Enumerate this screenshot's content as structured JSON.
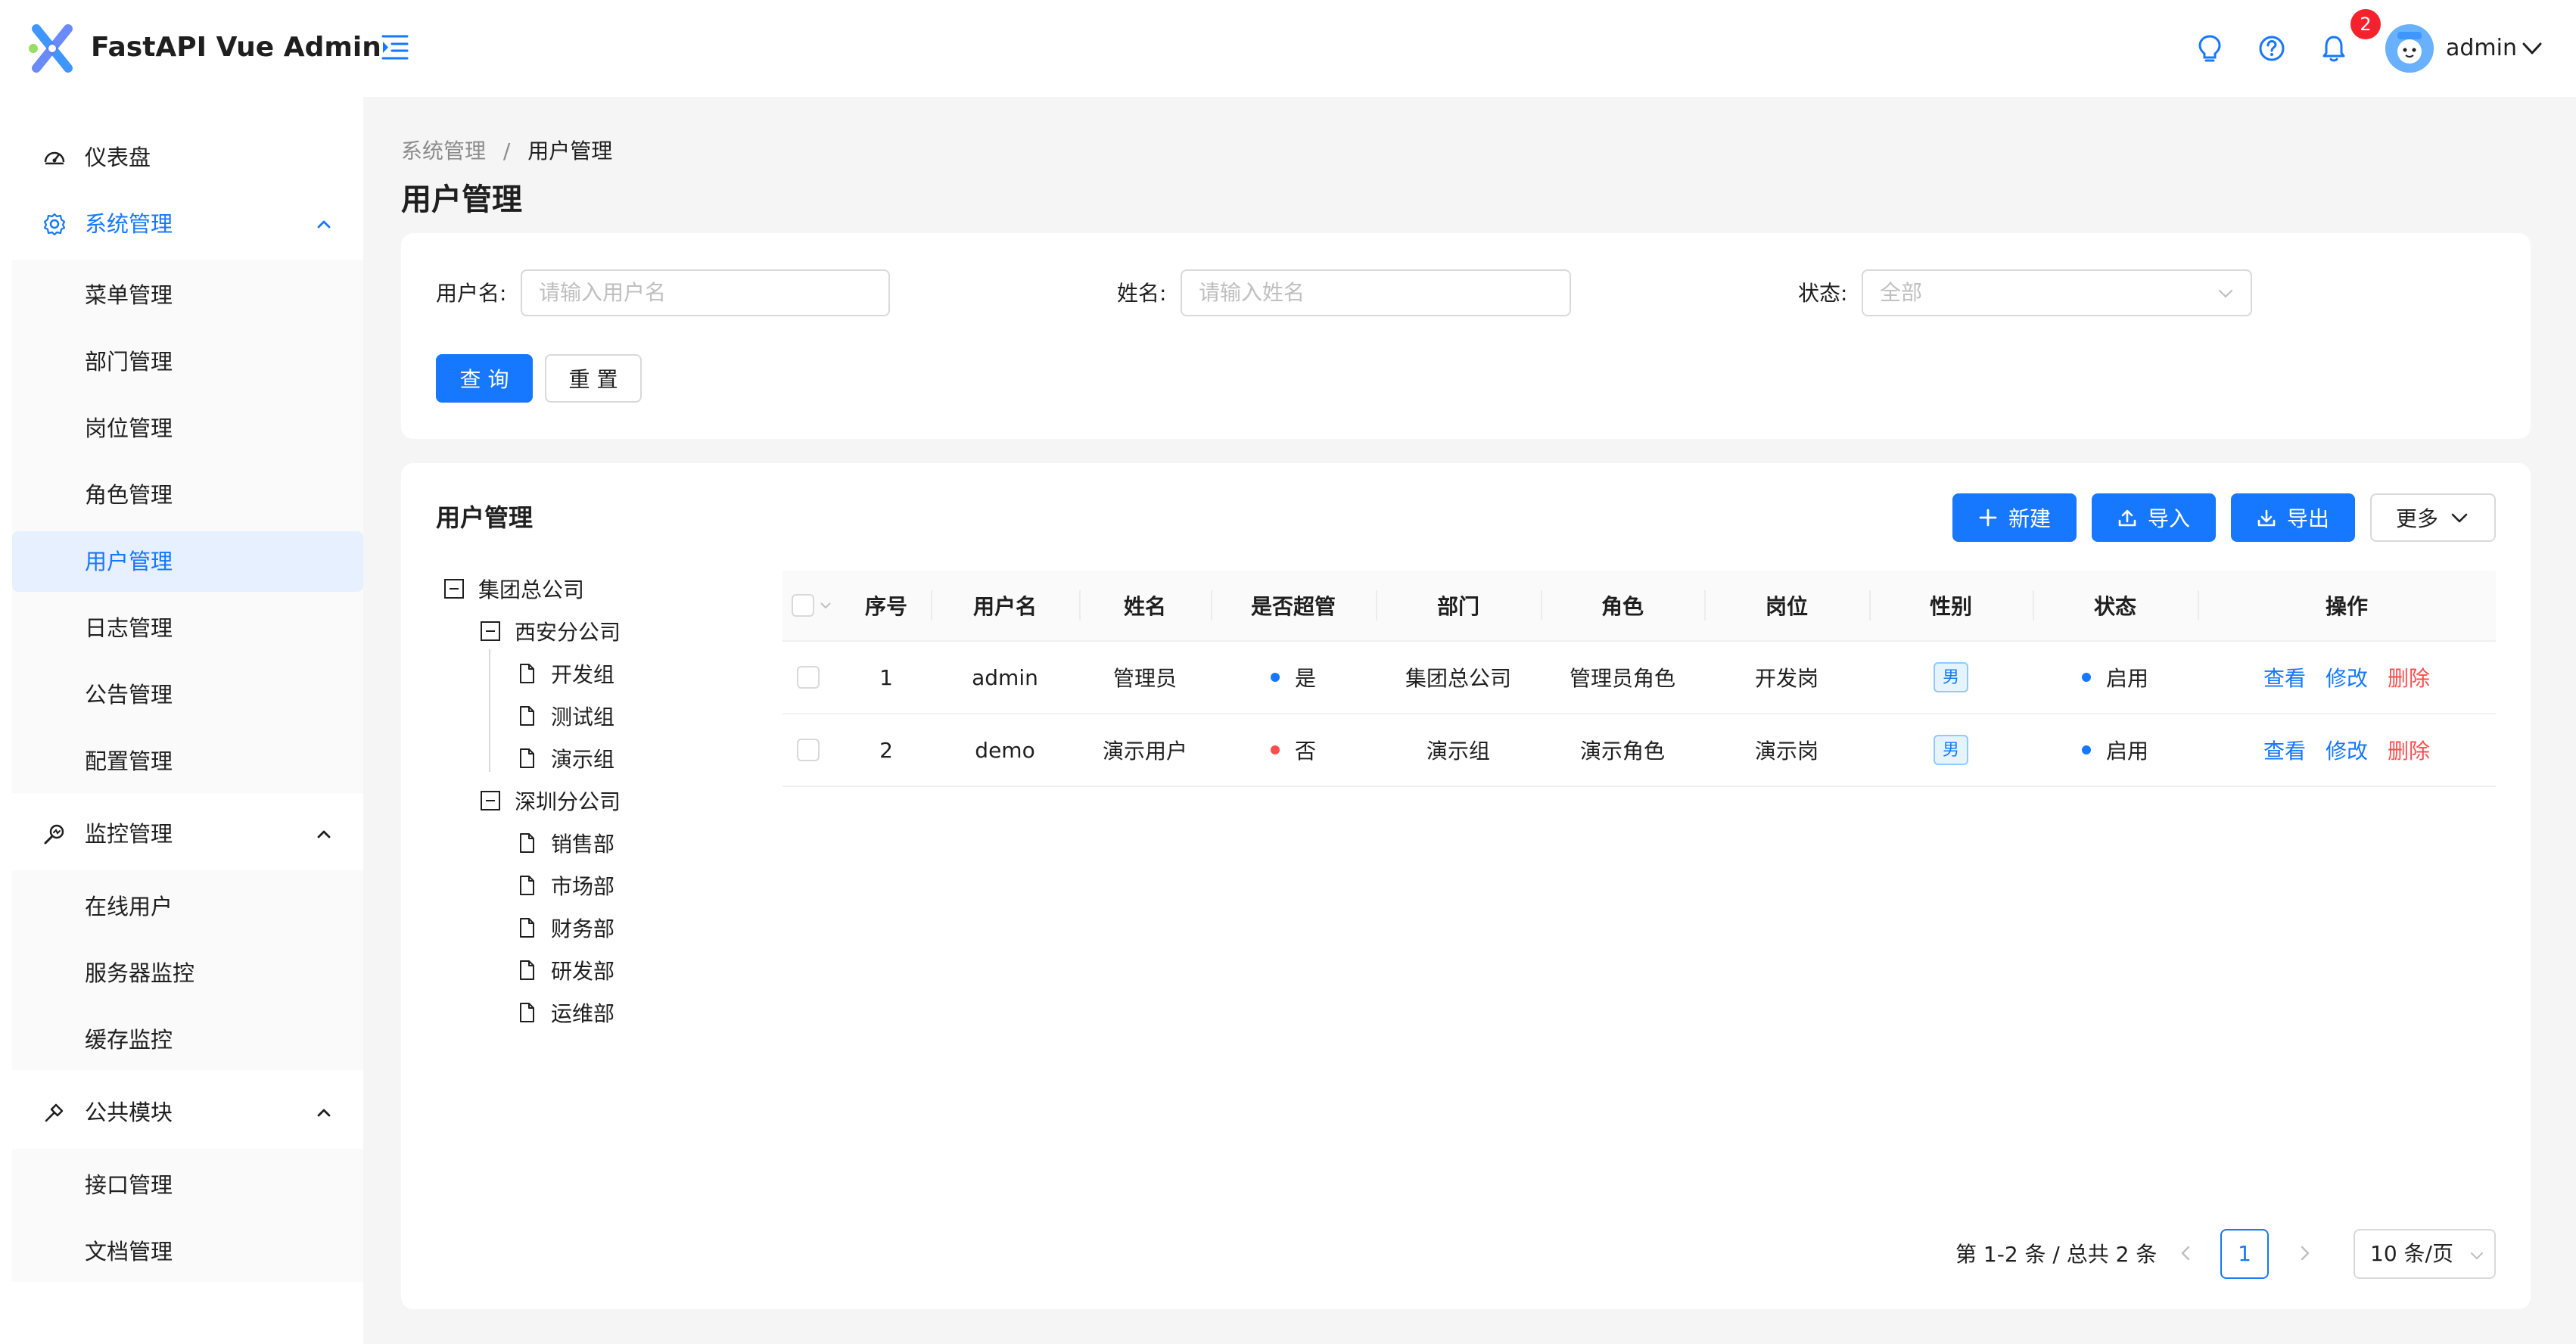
{
  "app": {
    "title": "FastAPI Vue Admin"
  },
  "header": {
    "notification_count": "2",
    "user_name": "admin"
  },
  "sidebar": {
    "items": [
      {
        "label": "仪表盘",
        "icon": "dashboard-icon"
      },
      {
        "label": "系统管理",
        "icon": "gear-icon",
        "expanded": true,
        "children": [
          "菜单管理",
          "部门管理",
          "岗位管理",
          "角色管理",
          "用户管理",
          "日志管理",
          "公告管理",
          "配置管理"
        ]
      },
      {
        "label": "监控管理",
        "icon": "monitor-icon",
        "expanded": true,
        "children": [
          "在线用户",
          "服务器监控",
          "缓存监控"
        ]
      },
      {
        "label": "公共模块",
        "icon": "module-icon",
        "expanded": true,
        "children": [
          "接口管理",
          "文档管理"
        ]
      }
    ],
    "active_item": "用户管理"
  },
  "breadcrumb": {
    "parent": "系统管理",
    "separator": "/",
    "current": "用户管理"
  },
  "page": {
    "title": "用户管理"
  },
  "search": {
    "username_label": "用户名:",
    "username_placeholder": "请输入用户名",
    "name_label": "姓名:",
    "name_placeholder": "请输入姓名",
    "status_label": "状态:",
    "status_placeholder": "全部",
    "query_label": "查 询",
    "reset_label": "重 置"
  },
  "table_card": {
    "title": "用户管理",
    "new_label": "新建",
    "import_label": "导入",
    "export_label": "导出",
    "more_label": "更多"
  },
  "tree": {
    "root": "集团总公司",
    "branches": [
      {
        "label": "西安分公司",
        "children": [
          "开发组",
          "测试组",
          "演示组"
        ]
      },
      {
        "label": "深圳分公司",
        "children": [
          "销售部",
          "市场部",
          "财务部",
          "研发部",
          "运维部"
        ]
      }
    ]
  },
  "table": {
    "columns": [
      "序号",
      "用户名",
      "姓名",
      "是否超管",
      "部门",
      "角色",
      "岗位",
      "性别",
      "状态",
      "操作"
    ],
    "rows": [
      {
        "index": "1",
        "username": "admin",
        "name": "管理员",
        "is_superuser": "是",
        "superuser_color": "#1677ff",
        "dept": "集团总公司",
        "role": "管理员角色",
        "position": "开发岗",
        "gender": "男",
        "status": "启用",
        "status_color": "#1677ff"
      },
      {
        "index": "2",
        "username": "demo",
        "name": "演示用户",
        "is_superuser": "否",
        "superuser_color": "#ff4d4f",
        "dept": "演示组",
        "role": "演示角色",
        "position": "演示岗",
        "gender": "男",
        "status": "启用",
        "status_color": "#1677ff"
      }
    ],
    "actions": {
      "view": "查看",
      "edit": "修改",
      "delete": "删除"
    }
  },
  "pagination": {
    "total_text": "第 1-2 条 / 总共 2 条",
    "current_page": "1",
    "page_size": "10 条/页"
  },
  "colors": {
    "primary": "#1677ff",
    "danger": "#ff4d4f",
    "badge": "#f5222d"
  }
}
